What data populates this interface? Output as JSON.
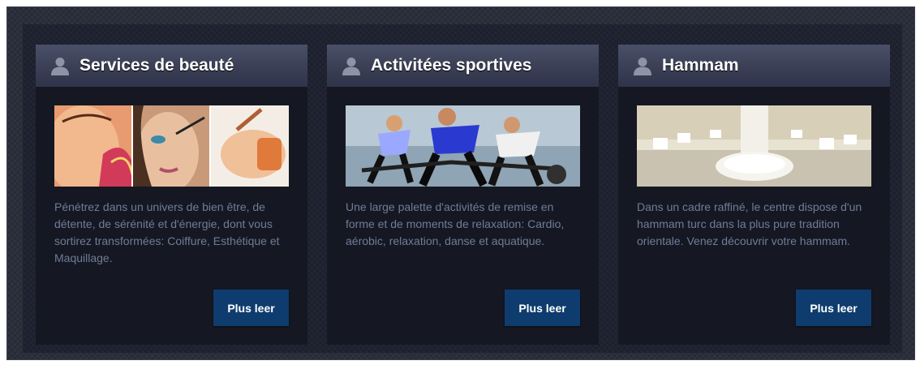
{
  "cards": [
    {
      "title": "Services de beauté",
      "icon": "user-icon",
      "image": "beauty-collage",
      "description": "Pénétrez dans un univers de bien être, de détente, de sérénité et d'énergie, dont vous sortirez transformées: Coiffure, Esthétique et Maquillage.",
      "button_label": "Plus leer"
    },
    {
      "title": "Activitées sportives",
      "icon": "user-icon",
      "image": "spinning-class",
      "description": "Une large palette d'activités de remise en forme et de moments de relaxation: Cardio, aérobic, relaxation, danse et aquatique.",
      "button_label": "Plus leer"
    },
    {
      "title": "Hammam",
      "icon": "user-icon",
      "image": "hammam-room",
      "description": "Dans un cadre raffiné, le centre dispose d'un hammam turc dans la plus pure tradition orientale. Venez découvrir votre hammam.",
      "button_label": "Plus leer"
    }
  ],
  "colors": {
    "header": "#3a3f55",
    "button": "#0e3c6e",
    "text": "#6f7c97",
    "card": "#151822"
  }
}
